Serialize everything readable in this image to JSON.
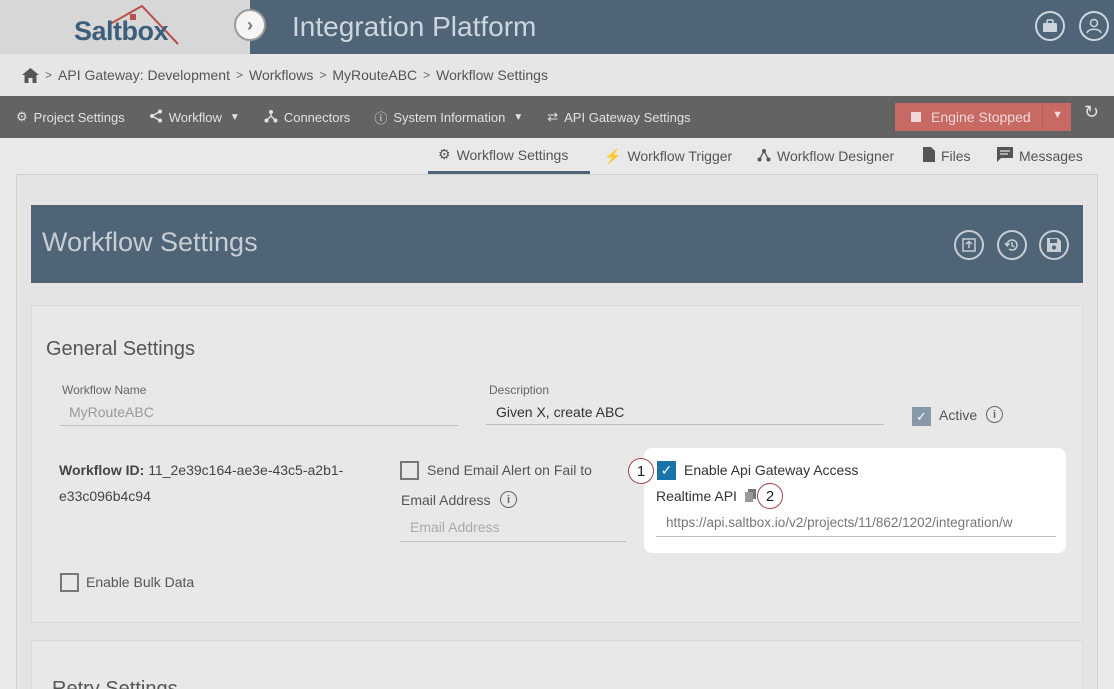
{
  "app": {
    "logo_text": "Saltbox",
    "title": "Integration Platform"
  },
  "breadcrumb": [
    "API Gateway: Development",
    "Workflows",
    "MyRouteABC",
    "Workflow Settings"
  ],
  "nav": {
    "project_settings": "Project Settings",
    "workflow": "Workflow",
    "connectors": "Connectors",
    "system_information": "System Information",
    "api_gateway_settings": "API Gateway Settings",
    "engine_status": "Engine Stopped"
  },
  "tabs": {
    "workflow_settings": "Workflow Settings",
    "workflow_trigger": "Workflow Trigger",
    "workflow_designer": "Workflow Designer",
    "files": "Files",
    "messages": "Messages"
  },
  "page": {
    "title": "Workflow Settings"
  },
  "general": {
    "section_title": "General Settings",
    "workflow_name_label": "Workflow Name",
    "workflow_name_value": "MyRouteABC",
    "description_label": "Description",
    "description_value": "Given X, create ABC",
    "active_label": "Active",
    "workflow_id_label": "Workflow ID:",
    "workflow_id_value_line1": "11_2e39c164-ae3e-43c5-a2b1-",
    "workflow_id_value_line2": "e33c096b4c94",
    "send_email_label": "Send Email Alert on Fail to",
    "email_address_label": "Email Address",
    "email_placeholder": "Email Address",
    "bulk_data_label": "Enable Bulk Data"
  },
  "api_gateway": {
    "enable_label": "Enable Api Gateway Access",
    "realtime_label": "Realtime API",
    "realtime_url": "https://api.saltbox.io/v2/projects/11/862/1202/integration/w"
  },
  "callouts": {
    "one": "1",
    "two": "2"
  },
  "retry": {
    "section_title": "Retry Settings"
  },
  "colors": {
    "header": "#4f6477",
    "navbar": "#636363",
    "engine_stopped": "#c76a63",
    "checkbox_blue": "#1a73a8"
  }
}
